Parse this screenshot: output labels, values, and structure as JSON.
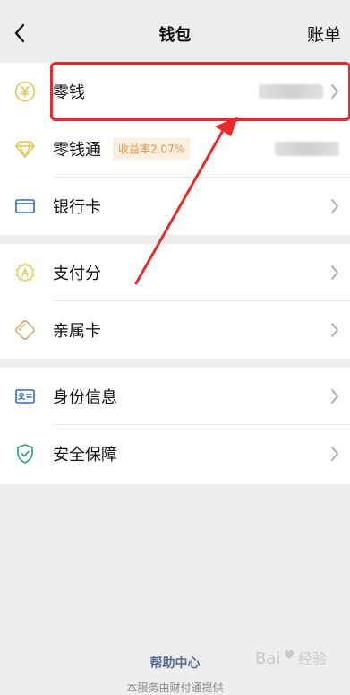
{
  "header": {
    "title": "钱包",
    "right_action": "账单"
  },
  "groups": [
    {
      "items": [
        {
          "key": "change",
          "label": "零钱",
          "value_hidden": true
        },
        {
          "key": "change-pass",
          "label": "零钱通",
          "badge": "收益率2.07%",
          "value_hidden": true
        },
        {
          "key": "bank-card",
          "label": "银行卡"
        }
      ]
    },
    {
      "items": [
        {
          "key": "pay-score",
          "label": "支付分"
        },
        {
          "key": "family-card",
          "label": "亲属卡"
        }
      ]
    },
    {
      "items": [
        {
          "key": "identity-info",
          "label": "身份信息"
        },
        {
          "key": "security",
          "label": "安全保障"
        }
      ]
    }
  ],
  "footer": {
    "help": "帮助中心",
    "note": "本服务由财付通提供"
  },
  "watermark": {
    "text": "Bai经验"
  },
  "colors": {
    "background": "#ededed",
    "card": "#ffffff",
    "accent_yellow": "#e3c54d",
    "accent_blue": "#2f6fb6",
    "accent_green": "#25a36f",
    "badge_bg": "#fbefe0",
    "badge_text": "#d79a4b",
    "highlight_red": "#e52b2b",
    "link_blue": "#576b95"
  },
  "icons": {
    "back": "chevron-left-icon",
    "change": "yen-coin-icon",
    "change_pass": "diamond-icon",
    "bank_card": "bank-card-icon",
    "pay_score": "badge-score-icon",
    "family_card": "family-card-icon",
    "identity": "id-card-icon",
    "security": "shield-check-icon",
    "chevron": "chevron-right-icon"
  }
}
